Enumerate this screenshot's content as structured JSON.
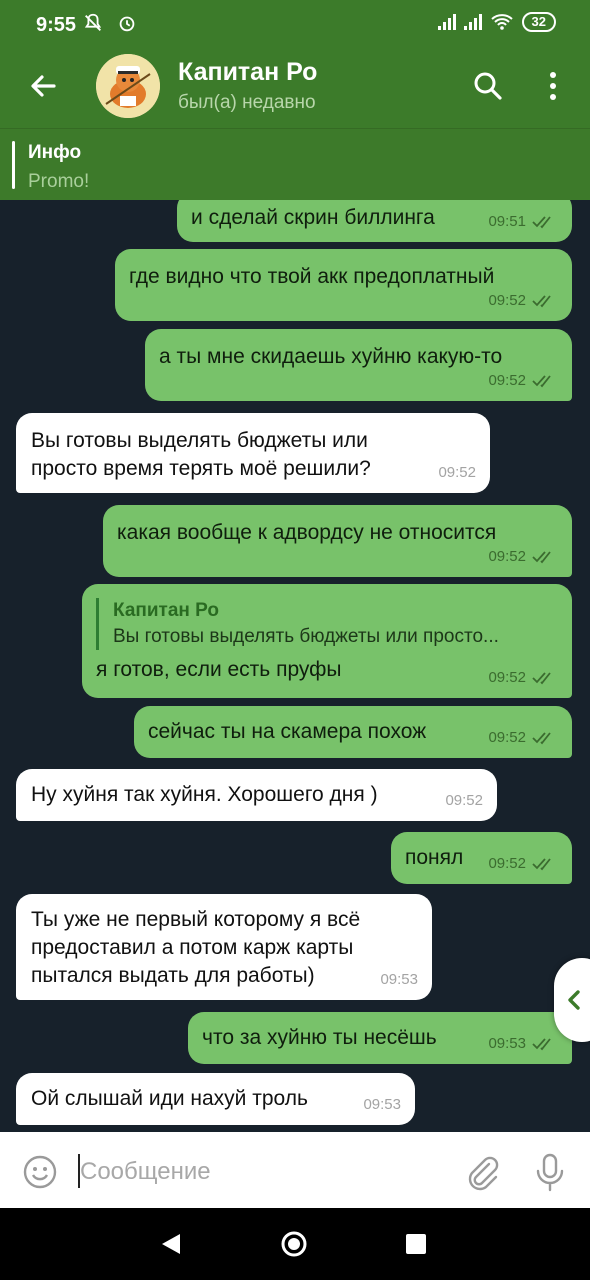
{
  "status_bar": {
    "time": "9:55",
    "battery": "32"
  },
  "header": {
    "title": "Капитан Ро",
    "subtitle": "был(а) недавно",
    "icons": [
      "back-arrow-icon",
      "search-icon",
      "more-vertical-icon"
    ]
  },
  "pinned": {
    "title": "Инфо",
    "text": "Promo!"
  },
  "messages": [
    {
      "dir": "out",
      "text": "и сделай скрин биллинга",
      "time": "09:51",
      "read": true
    },
    {
      "dir": "out",
      "text": "где видно что твой акк предоплатный",
      "time": "09:52",
      "read": true
    },
    {
      "dir": "out",
      "text": "а ты мне скидаешь хуйню какую-то",
      "time": "09:52",
      "read": true
    },
    {
      "dir": "in",
      "text": "Вы готовы выделять бюджеты или просто время терять моё решили?",
      "time": "09:52"
    },
    {
      "dir": "out",
      "text": "какая вообще к адвордсу не относится",
      "time": "09:52",
      "read": true
    },
    {
      "dir": "out",
      "reply_to": {
        "name": "Капитан Ро",
        "text": "Вы готовы выделять бюджеты или просто..."
      },
      "text": "я готов, если есть пруфы",
      "time": "09:52",
      "read": true
    },
    {
      "dir": "out",
      "text": "сейчас ты на скамера похож",
      "time": "09:52",
      "read": true
    },
    {
      "dir": "in",
      "text": "Ну хуйня так хуйня. Хорошего дня )",
      "time": "09:52"
    },
    {
      "dir": "out",
      "text": "понял",
      "time": "09:52",
      "read": true
    },
    {
      "dir": "in",
      "text": "Ты уже не первый которому я всё предоставил а потом карж карты пытался выдать для работы)",
      "time": "09:53"
    },
    {
      "dir": "out",
      "text": "что за хуйню ты несёшь",
      "time": "09:53",
      "read": true
    },
    {
      "dir": "in",
      "text": "Ой слышай иди нахуй троль",
      "time": "09:53"
    }
  ],
  "composer": {
    "placeholder": "Сообщение"
  },
  "colors": {
    "header": "#3c7b2a",
    "bubble_out": "#78c26a",
    "bubble_in": "#ffffff",
    "chat_bg": "#17212b"
  }
}
